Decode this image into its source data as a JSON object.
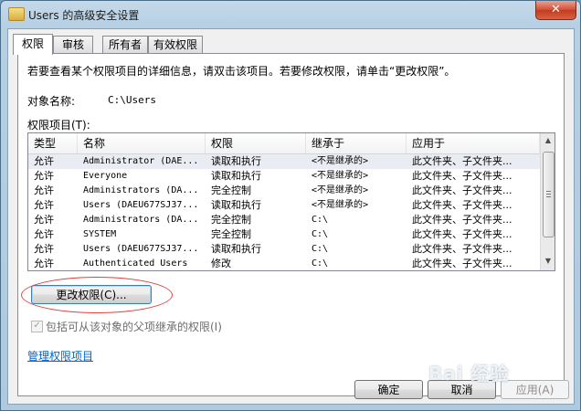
{
  "window": {
    "title": "Users 的高级安全设置",
    "close_label": "✕"
  },
  "tabs": [
    "权限",
    "审核",
    "所有者",
    "有效权限"
  ],
  "intro_text": "若要查看某个权限项目的详细信息，请双击该项目。若要修改权限，请单击“更改权限”。",
  "object": {
    "label": "对象名称:",
    "value": "C:\\Users"
  },
  "entries_label": "权限项目(T):",
  "columns": [
    "类型",
    "名称",
    "权限",
    "继承于",
    "应用于"
  ],
  "rows": [
    {
      "type": "允许",
      "name": "Administrator (DAE...",
      "permission": "读取和执行",
      "inherited_from": "<不是继承的>",
      "applies_to": "此文件夹、子文件夹..."
    },
    {
      "type": "允许",
      "name": "Everyone",
      "permission": "读取和执行",
      "inherited_from": "<不是继承的>",
      "applies_to": "此文件夹、子文件夹..."
    },
    {
      "type": "允许",
      "name": "Administrators (DA...",
      "permission": "完全控制",
      "inherited_from": "<不是继承的>",
      "applies_to": "此文件夹、子文件夹..."
    },
    {
      "type": "允许",
      "name": "Users (DAEU677SJ37...",
      "permission": "读取和执行",
      "inherited_from": "<不是继承的>",
      "applies_to": "此文件夹、子文件夹..."
    },
    {
      "type": "允许",
      "name": "Administrators (DA...",
      "permission": "完全控制",
      "inherited_from": "C:\\",
      "applies_to": "此文件夹、子文件夹..."
    },
    {
      "type": "允许",
      "name": "SYSTEM",
      "permission": "完全控制",
      "inherited_from": "C:\\",
      "applies_to": "此文件夹、子文件夹..."
    },
    {
      "type": "允许",
      "name": "Users (DAEU677SJ37...",
      "permission": "读取和执行",
      "inherited_from": "C:\\",
      "applies_to": "此文件夹、子文件夹..."
    },
    {
      "type": "允许",
      "name": "Authenticated Users",
      "permission": "修改",
      "inherited_from": "C:\\",
      "applies_to": "此文件夹、子文件夹..."
    }
  ],
  "change_permissions_button": "更改权限(C)...",
  "inherit_checkbox": {
    "label": "包括可从该对象的父项继承的权限(I)",
    "checked": true,
    "mark": "✓"
  },
  "manage_link": "管理权限项目",
  "footer_buttons": {
    "ok": "确定",
    "cancel": "取消",
    "apply": "应用(A)"
  },
  "watermark": "Bai 经验",
  "colors": {
    "link": "#0066cc",
    "annotation": "#e0403e",
    "close": "#c23a22"
  }
}
